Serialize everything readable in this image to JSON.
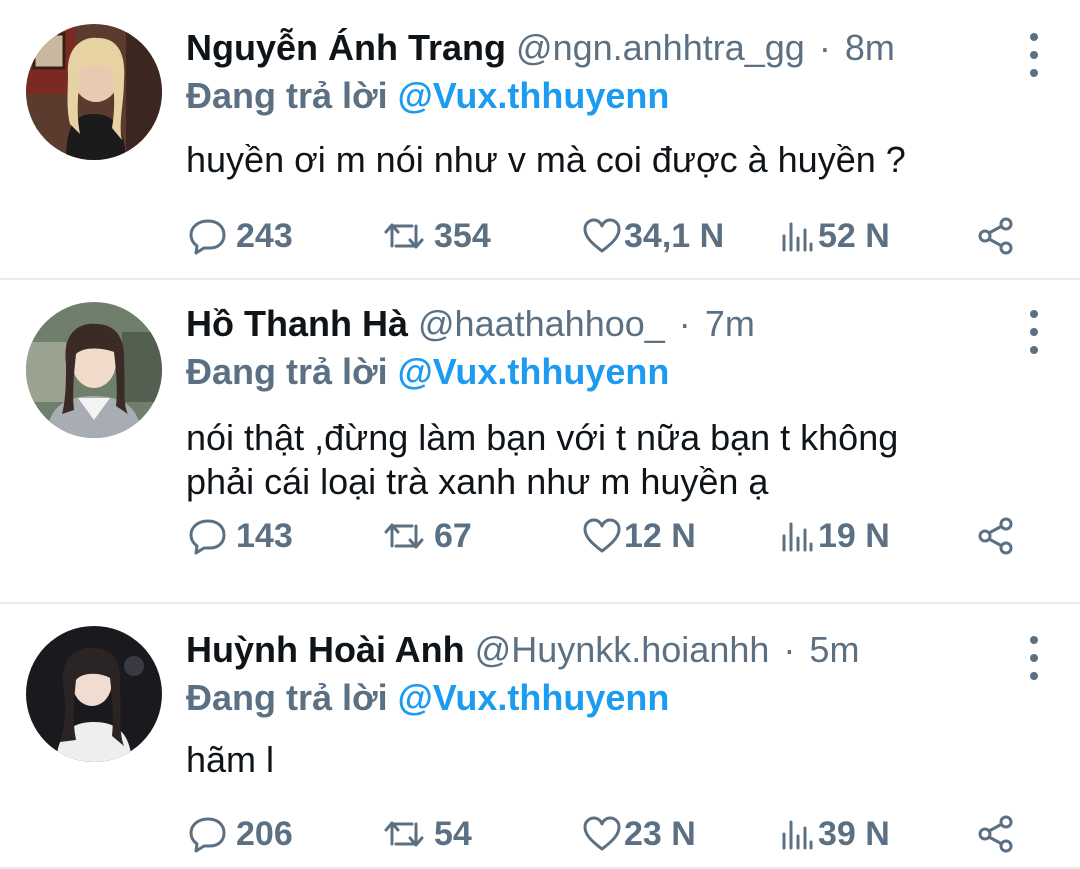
{
  "tweets": [
    {
      "name": "Nguyễn Ánh Trang",
      "handle": "@ngn.anhhtra_gg",
      "separator": "·",
      "time": "8m",
      "replying_label": "Đang trả lời",
      "replying_to": "@Vux.thhuyenn",
      "body_lines": [
        "huyền ơi m nói như v mà coi được à huyền ?"
      ],
      "replies": "243",
      "retweets": "354",
      "likes": "34,1 N",
      "views": "52 N"
    },
    {
      "name": "Hồ Thanh Hà",
      "handle": "@haathahhoo_",
      "separator": "·",
      "time": "7m",
      "replying_label": "Đang trả lời",
      "replying_to": "@Vux.thhuyenn",
      "body_lines": [
        "nói thật ,đừng làm bạn với t nữa bạn t không",
        "phải cái loại trà xanh như m huyền ạ"
      ],
      "replies": "143",
      "retweets": "67",
      "likes": "12 N",
      "views": "19 N"
    },
    {
      "name": "Huỳnh Hoài Anh",
      "handle": "@Huynkk.hoianhh",
      "separator": "·",
      "time": "5m",
      "replying_label": "Đang trả lời",
      "replying_to": "@Vux.thhuyenn",
      "body_lines": [
        "hãm l"
      ],
      "replies": "206",
      "retweets": "54",
      "likes": "23 N",
      "views": "39 N"
    }
  ],
  "colors": {
    "text": "#0f1419",
    "secondary": "#5b7083",
    "accent": "#1d9bf0",
    "divider": "#e6ecf0"
  },
  "icons": {
    "reply": "reply-icon",
    "retweet": "retweet-icon",
    "like": "heart-icon",
    "views": "views-icon",
    "share": "share-icon",
    "more": "more-vertical-icon"
  }
}
